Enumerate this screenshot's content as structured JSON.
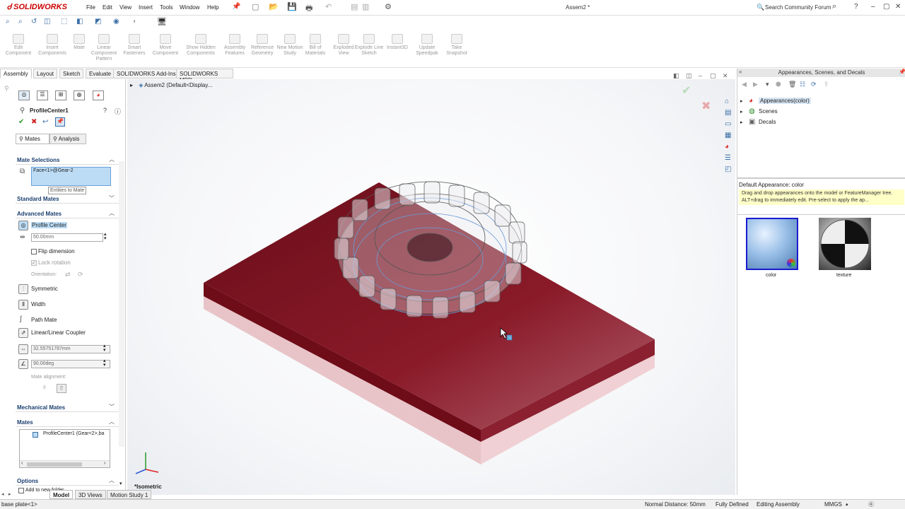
{
  "app": {
    "logo": "SOLIDWORKS",
    "document_title": "Assem2 *"
  },
  "menu": [
    "File",
    "Edit",
    "View",
    "Insert",
    "Tools",
    "Window",
    "Help"
  ],
  "search": {
    "placeholder": "Search Community Forum"
  },
  "ribbon": [
    {
      "label": "Edit Component"
    },
    {
      "label": "Insert Components"
    },
    {
      "label": "Mate"
    },
    {
      "label": "Linear Component Pattern"
    },
    {
      "label": "Smart Fasteners"
    },
    {
      "label": "Move Component"
    },
    {
      "label": "Show Hidden Components"
    },
    {
      "label": "Assembly Features"
    },
    {
      "label": "Reference Geometry"
    },
    {
      "label": "New Motion Study"
    },
    {
      "label": "Bill of Materials"
    },
    {
      "label": "Exploded View"
    },
    {
      "label": "Explode Line Sketch"
    },
    {
      "label": "Instant3D"
    },
    {
      "label": "Update Speedpak"
    },
    {
      "label": "Take Snapshot"
    }
  ],
  "tabs": [
    "Assembly",
    "Layout",
    "Sketch",
    "Evaluate",
    "SOLIDWORKS Add-Ins",
    "SOLIDWORKS MBD"
  ],
  "property_manager": {
    "title": "ProfileCenter1",
    "subtabs": {
      "mates": "Mates",
      "analysis": "Analysis"
    },
    "mate_selections": {
      "header": "Mate Selections",
      "item": "Face<1>@Gear-2",
      "tooltip": "Entities to Mate"
    },
    "standard_mates": "Standard Mates",
    "advanced_mates": {
      "header": "Advanced Mates",
      "profile_center": "Profile Center",
      "distance": "50.00mm",
      "flip_dimension": "Flip dimension",
      "lock_rotation": "Lock rotation",
      "orientation": "Orientation:",
      "symmetric": "Symmetric",
      "width": "Width",
      "path_mate": "Path Mate",
      "linear_coupler": "Linear/Linear Coupler",
      "coupler_value": "32.55751787mm",
      "angle_value": "90.00deg",
      "mate_alignment": "Mate alignment:"
    },
    "mechanical_mates": "Mechanical Mates",
    "mates": {
      "header": "Mates",
      "item": "ProfileCenter1 (Gear<2>,ba"
    },
    "options": {
      "header": "Options",
      "add_to_folder": "Add to new folder"
    }
  },
  "viewport": {
    "tree_root": "Assem2 (Default<Display...",
    "view_label": "*Isometric"
  },
  "right_panel": {
    "title": "Appearances, Scenes, and Decals",
    "tree": [
      "Appearances(color)",
      "Scenes",
      "Decals"
    ],
    "default_appearance": "Default Appearance: color",
    "hint": "Drag and drop appearances onto the model or FeatureManager tree.  ALT+drag to immediately edit.  Pre-select to apply the ap...",
    "swatches": [
      {
        "label": "color"
      },
      {
        "label": "texture"
      }
    ]
  },
  "bottom_tabs": [
    "Model",
    "3D Views",
    "Motion Study 1"
  ],
  "status": {
    "left": "base plate<1>",
    "normal_distance": "Normal Distance: 50mm",
    "state": "Fully Defined",
    "mode": "Editing Assembly",
    "units": "MMGS"
  },
  "colors": {
    "plate": "#7a1420",
    "accent": "#1c3f70",
    "selection": "#bcdcf5"
  }
}
